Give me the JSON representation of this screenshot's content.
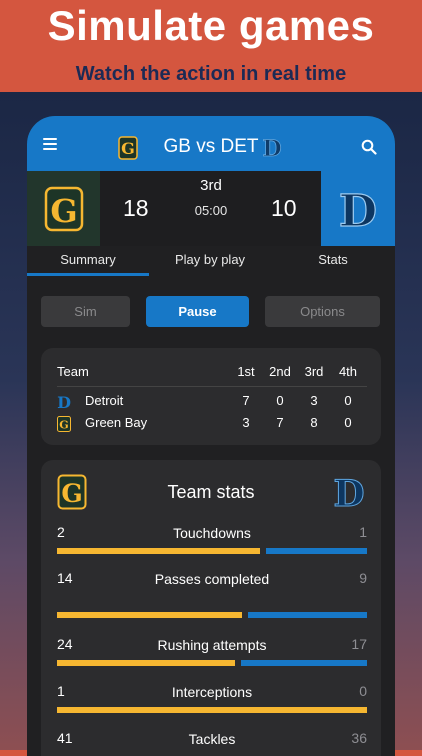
{
  "promo": {
    "title": "Simulate games",
    "subtitle": "Watch the action in real time"
  },
  "appbar": {
    "title": "GB vs DET",
    "icons": [
      "menu-icon",
      "search-icon"
    ]
  },
  "scoreboard": {
    "home_score": "18",
    "away_score": "10",
    "quarter": "3rd",
    "clock": "05:00",
    "home_logo": "G",
    "away_logo": "D"
  },
  "tabs": [
    "Summary",
    "Play by play",
    "Stats"
  ],
  "controls": {
    "sim": "Sim",
    "pause": "Pause",
    "options": "Options"
  },
  "quarters": {
    "headers": [
      "Team",
      "1st",
      "2nd",
      "3rd",
      "4th"
    ],
    "rows": [
      {
        "team": "Detroit",
        "logo": "D",
        "values": [
          "7",
          "0",
          "3",
          "0"
        ]
      },
      {
        "team": "Green Bay",
        "logo": "G",
        "values": [
          "3",
          "7",
          "8",
          "0"
        ]
      }
    ]
  },
  "team_stats": {
    "title": "Team stats",
    "stats": [
      {
        "label": "Touchdowns",
        "left": "2",
        "right": "1",
        "left_share": 0.667
      },
      {
        "label": "Passes completed",
        "left": "14",
        "right": "9",
        "left_share": 0.609
      },
      {
        "label": "Rushing attempts",
        "left": "24",
        "right": "17",
        "left_share": 0.585
      },
      {
        "label": "Interceptions",
        "left": "1",
        "right": "0",
        "left_share": 1.0
      },
      {
        "label": "Tackles",
        "left": "41",
        "right": "36"
      }
    ]
  },
  "colors": {
    "green_bay": "#f6b731",
    "detroit": "#1778c7",
    "promo_bg": "#d4563f"
  }
}
